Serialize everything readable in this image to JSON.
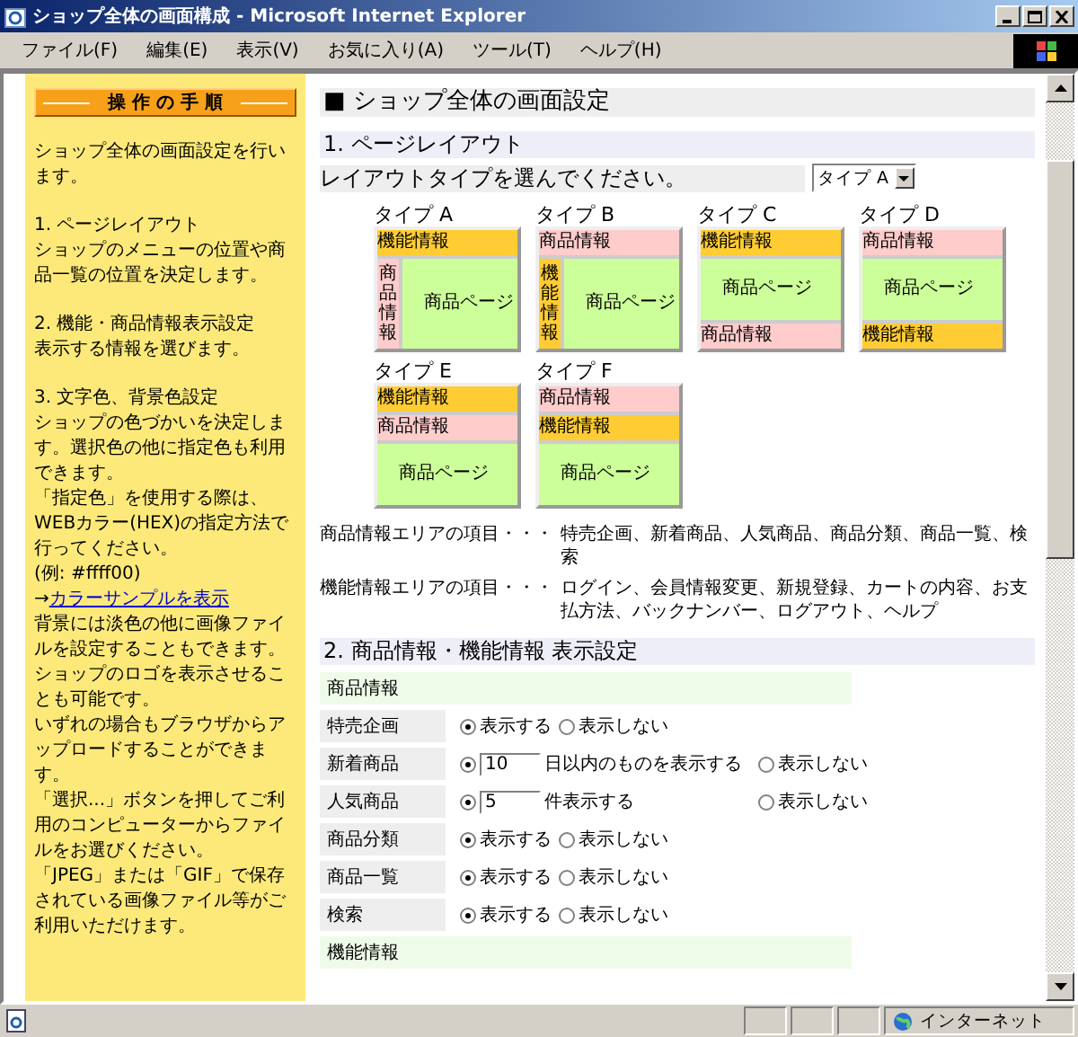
{
  "window": {
    "title": "ショップ全体の画面構成 - Microsoft Internet Explorer"
  },
  "menu": [
    "ファイル(F)",
    "編集(E)",
    "表示(V)",
    "お気に入り(A)",
    "ツール(T)",
    "ヘルプ(H)"
  ],
  "sidebar": {
    "heading": "操 作 の 手 順",
    "paragraphs": [
      [
        {
          "kind": "text",
          "text": "ショップ全体の画面設定を行います。"
        }
      ],
      [
        {
          "kind": "text",
          "text": "1. ページレイアウト"
        },
        {
          "kind": "text",
          "text": "ショップのメニューの位置や商品一覧の位置を決定します。"
        }
      ],
      [
        {
          "kind": "text",
          "text": "2. 機能・商品情報表示設定"
        },
        {
          "kind": "text",
          "text": "表示する情報を選びます。"
        }
      ],
      [
        {
          "kind": "text",
          "text": "3. 文字色、背景色設定"
        },
        {
          "kind": "text",
          "text": "ショップの色づかいを決定します。選択色の他に指定色も利用できます。"
        },
        {
          "kind": "text",
          "text": "「指定色」を使用する際は、WEBカラー(HEX)の指定方法で行ってください。"
        },
        {
          "kind": "text",
          "text": "(例: #ffff00)"
        },
        {
          "kind": "link",
          "prefix": "→",
          "text": "カラーサンプルを表示"
        },
        {
          "kind": "text",
          "text": "背景には淡色の他に画像ファイルを設定することもできます。"
        },
        {
          "kind": "text",
          "text": "ショップのロゴを表示させることも可能です。"
        },
        {
          "kind": "text",
          "text": "いずれの場合もブラウザからアップロードすることができます。"
        },
        {
          "kind": "text",
          "text": "「選択...」ボタンを押してご利用のコンピューターからファイルをお選びください。"
        },
        {
          "kind": "text",
          "text": "「JPEG」または「GIF」で保存されている画像ファイル等がご利用いただけます。"
        }
      ]
    ]
  },
  "main": {
    "title": "■ ショップ全体の画面設定",
    "layout_section": {
      "heading": "1. ページレイアウト",
      "prompt": "レイアウトタイプを選んでください。",
      "select": {
        "value": "タイプ A"
      },
      "layouts": [
        {
          "label": "タイプ A",
          "kind": "sidebar",
          "blocks": [
            {
              "kind": "function",
              "text": "機能情報"
            },
            {
              "kind": "product",
              "text": "商品情報"
            },
            {
              "kind": "page",
              "text": "商品ページ"
            }
          ]
        },
        {
          "label": "タイプ B",
          "kind": "sidebar",
          "blocks": [
            {
              "kind": "product",
              "text": "商品情報"
            },
            {
              "kind": "function",
              "text": "機能情報"
            },
            {
              "kind": "page",
              "text": "商品ページ"
            }
          ]
        },
        {
          "label": "タイプ C",
          "kind": "stacked",
          "blocks": [
            {
              "kind": "function",
              "text": "機能情報"
            },
            {
              "kind": "page",
              "text": "商品ページ"
            },
            {
              "kind": "product",
              "text": "商品情報"
            }
          ]
        },
        {
          "label": "タイプ D",
          "kind": "stacked",
          "blocks": [
            {
              "kind": "product",
              "text": "商品情報"
            },
            {
              "kind": "page",
              "text": "商品ページ"
            },
            {
              "kind": "function",
              "text": "機能情報"
            }
          ]
        },
        {
          "label": "タイプ E",
          "kind": "stacked",
          "blocks": [
            {
              "kind": "function",
              "text": "機能情報"
            },
            {
              "kind": "product",
              "text": "商品情報"
            },
            {
              "kind": "page",
              "text": "商品ページ"
            }
          ]
        },
        {
          "label": "タイプ F",
          "kind": "stacked",
          "blocks": [
            {
              "kind": "product",
              "text": "商品情報"
            },
            {
              "kind": "function",
              "text": "機能情報"
            },
            {
              "kind": "page",
              "text": "商品ページ"
            }
          ]
        }
      ],
      "areas": [
        {
          "label": "商品情報エリアの項目・・・",
          "items": "特売企画、新着商品、人気商品、商品分類、商品一覧、検索"
        },
        {
          "label": "機能情報エリアの項目・・・",
          "items": "ログイン、会員情報変更、新規登録、カートの内容、お支払方法、バックナンバー、ログアウト、ヘルプ"
        }
      ]
    },
    "display_section": {
      "heading": "2. 商品情報・機能情報 表示設定",
      "rows": [
        {
          "kind": "header",
          "label": "商品情報"
        },
        {
          "kind": "option",
          "label": "特売企画",
          "options": [
            {
              "label": "表示する",
              "selected": true
            },
            {
              "label": "表示しない",
              "selected": false
            }
          ]
        },
        {
          "kind": "option",
          "label": "新着商品",
          "options": [
            {
              "label": "日以内のものを表示する",
              "value": "10",
              "selected": true
            },
            {
              "label": "表示しない",
              "selected": false
            }
          ]
        },
        {
          "kind": "option",
          "label": "人気商品",
          "options": [
            {
              "label": "件表示する",
              "value": "5",
              "selected": true
            },
            {
              "label": "表示しない",
              "selected": false
            }
          ]
        },
        {
          "kind": "option",
          "label": "商品分類",
          "options": [
            {
              "label": "表示する",
              "selected": true
            },
            {
              "label": "表示しない",
              "selected": false
            }
          ]
        },
        {
          "kind": "option",
          "label": "商品一覧",
          "options": [
            {
              "label": "表示する",
              "selected": true
            },
            {
              "label": "表示しない",
              "selected": false
            }
          ]
        },
        {
          "kind": "option",
          "label": "検索",
          "options": [
            {
              "label": "表示する",
              "selected": true
            },
            {
              "label": "表示しない",
              "selected": false
            }
          ]
        },
        {
          "kind": "header",
          "label": "機能情報"
        }
      ]
    }
  },
  "status_bar": {
    "zone": "インターネット"
  }
}
